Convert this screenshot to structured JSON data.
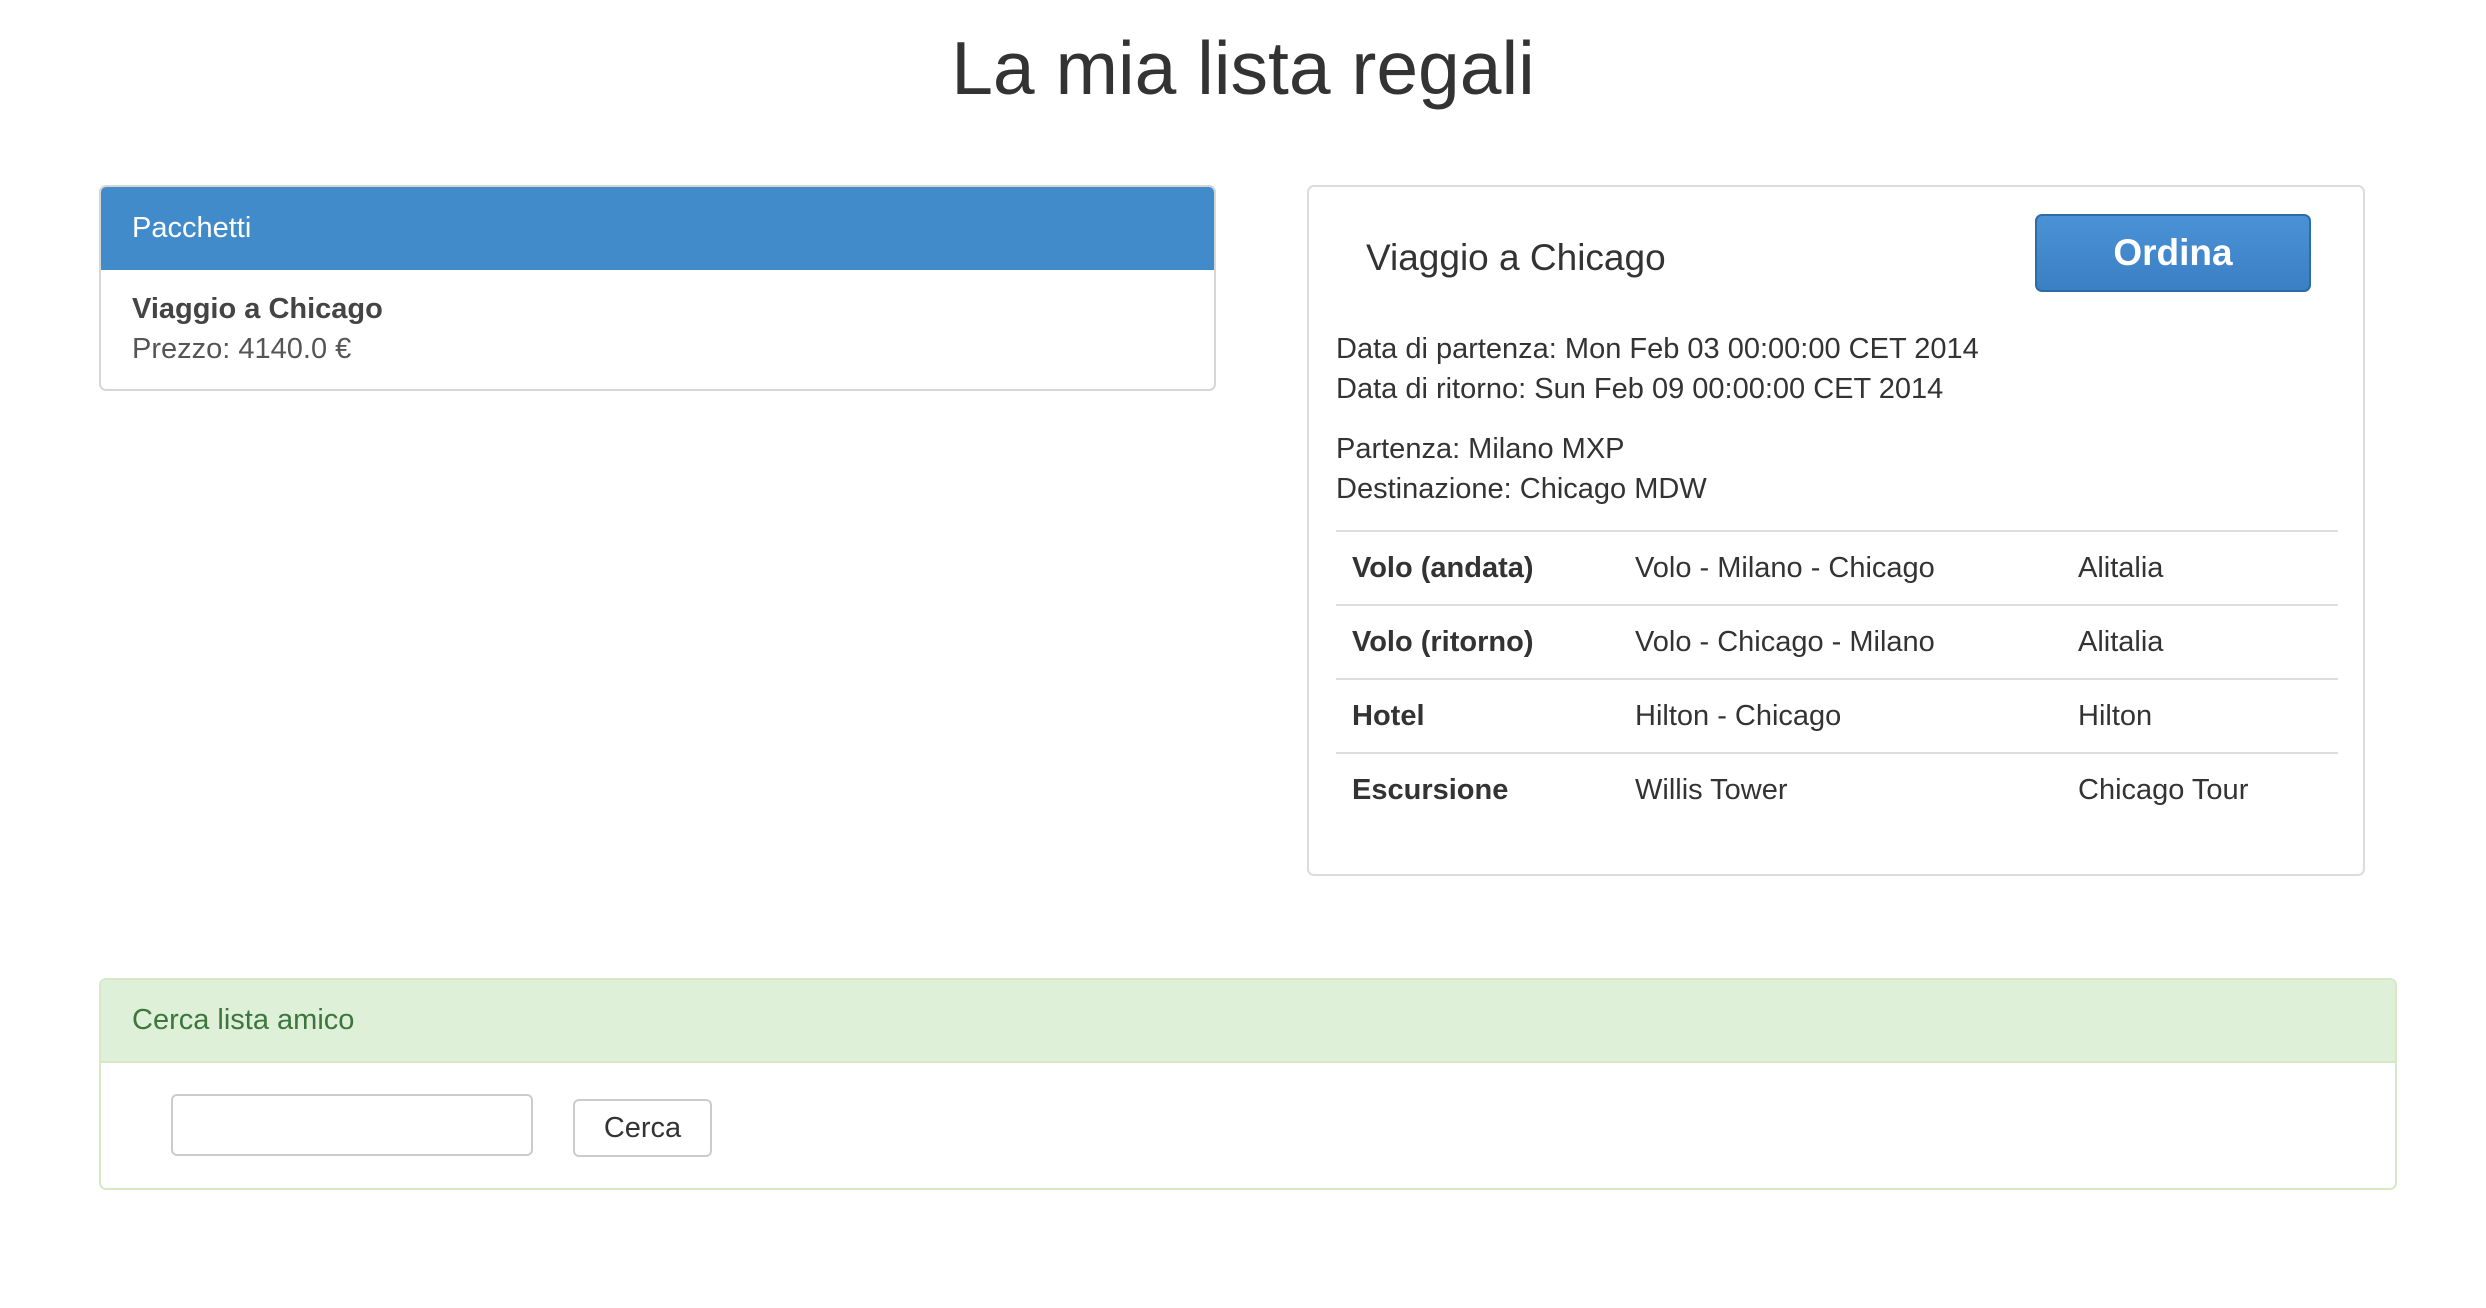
{
  "page": {
    "title": "La mia lista regali"
  },
  "packages_panel": {
    "heading": "Pacchetti",
    "items": [
      {
        "name": "Viaggio a Chicago",
        "price": "Prezzo: 4140.0 €"
      }
    ]
  },
  "detail_panel": {
    "title": "Viaggio a Chicago",
    "order_label": "Ordina",
    "departure_date": "Data di partenza: Mon Feb 03 00:00:00 CET 2014",
    "return_date": "Data di ritorno: Sun Feb 09 00:00:00 CET 2014",
    "origin": "Partenza: Milano MXP",
    "destination": "Destinazione: Chicago MDW",
    "services": [
      {
        "type": "Volo (andata)",
        "name": "Volo - Milano - Chicago",
        "provider": "Alitalia"
      },
      {
        "type": "Volo (ritorno)",
        "name": "Volo - Chicago - Milano",
        "provider": "Alitalia"
      },
      {
        "type": "Hotel",
        "name": "Hilton - Chicago",
        "provider": "Hilton"
      },
      {
        "type": "Escursione",
        "name": "Willis Tower",
        "provider": "Chicago Tour"
      }
    ]
  },
  "search_panel": {
    "heading": "Cerca lista amico",
    "input_value": "",
    "input_placeholder": "",
    "button_label": "Cerca"
  },
  "colors": {
    "primary": "#428bca",
    "success_bg": "#dff0d8",
    "success_text": "#3c763d"
  }
}
